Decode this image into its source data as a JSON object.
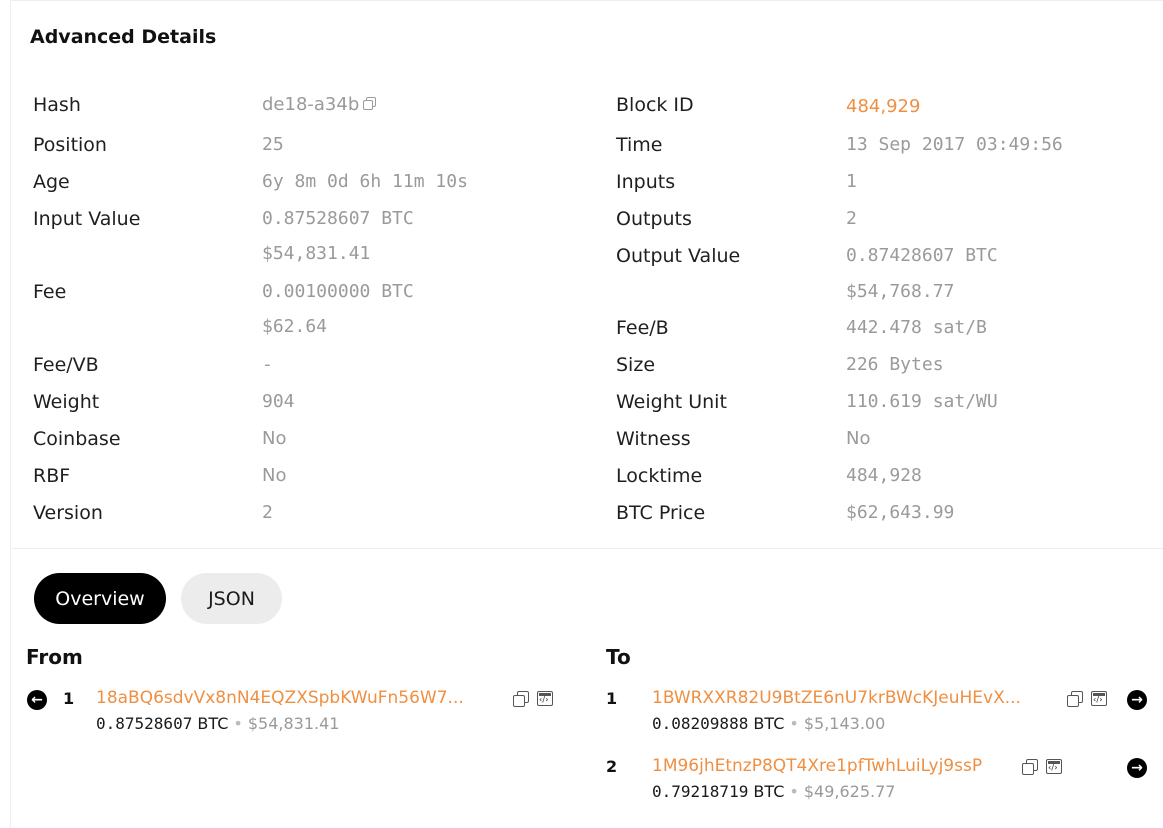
{
  "section_title": "Advanced Details",
  "left": {
    "hash_label": "Hash",
    "hash_value": "de18-a34b",
    "position_label": "Position",
    "position_value": "25",
    "age_label": "Age",
    "age_value": "6y 8m 0d 6h 11m 10s",
    "input_value_label": "Input Value",
    "input_value_btc": "0.87528607 BTC",
    "input_value_usd": "$54,831.41",
    "fee_label": "Fee",
    "fee_btc": "0.00100000 BTC",
    "fee_usd": "$62.64",
    "feevb_label": "Fee/VB",
    "feevb_value": "-",
    "weight_label": "Weight",
    "weight_value": "904",
    "coinbase_label": "Coinbase",
    "coinbase_value": "No",
    "rbf_label": "RBF",
    "rbf_value": "No",
    "version_label": "Version",
    "version_value": "2"
  },
  "right": {
    "block_label": "Block ID",
    "block_value": "484,929",
    "time_label": "Time",
    "time_value": "13 Sep 2017 03:49:56",
    "inputs_label": "Inputs",
    "inputs_value": "1",
    "outputs_label": "Outputs",
    "outputs_value": "2",
    "output_value_label": "Output Value",
    "output_value_btc": "0.87428607 BTC",
    "output_value_usd": "$54,768.77",
    "feeb_label": "Fee/B",
    "feeb_value": "442.478 sat/B",
    "size_label": "Size",
    "size_value": "226 Bytes",
    "weight_unit_label": "Weight Unit",
    "weight_unit_value": "110.619 sat/WU",
    "witness_label": "Witness",
    "witness_value": "No",
    "locktime_label": "Locktime",
    "locktime_value": "484,928",
    "btc_price_label": "BTC Price",
    "btc_price_value": "$62,643.99"
  },
  "tabs": {
    "overview": "Overview",
    "json": "JSON"
  },
  "from": {
    "heading": "From",
    "items": [
      {
        "index": "1",
        "address": "18aBQ6sdvVx8nN4EQZXSpbKWuFn56W7...",
        "btc": "0.87528607",
        "btc_unit": "BTC",
        "usd": "$54,831.41"
      }
    ]
  },
  "to": {
    "heading": "To",
    "items": [
      {
        "index": "1",
        "address": "1BWRXXR82U9BtZE6nU7krBWcKJeuHEvX...",
        "btc": "0.08209888",
        "btc_unit": "BTC",
        "usd": "$5,143.00"
      },
      {
        "index": "2",
        "address": "1M96jhEtnzP8QT4Xre1pfTwhLuiLyj9ssP",
        "btc": "0.79218719",
        "btc_unit": "BTC",
        "usd": "$49,625.77"
      }
    ]
  },
  "colors": {
    "accent": "#ef8f42",
    "muted": "#9a9a9a",
    "tab_active_bg": "#000000",
    "tab_inactive_bg": "#ececec"
  },
  "icons": {
    "copy": "copy-icon",
    "script": "script-icon",
    "arrow_left": "arrow-left-icon",
    "arrow_right": "arrow-right-icon"
  }
}
